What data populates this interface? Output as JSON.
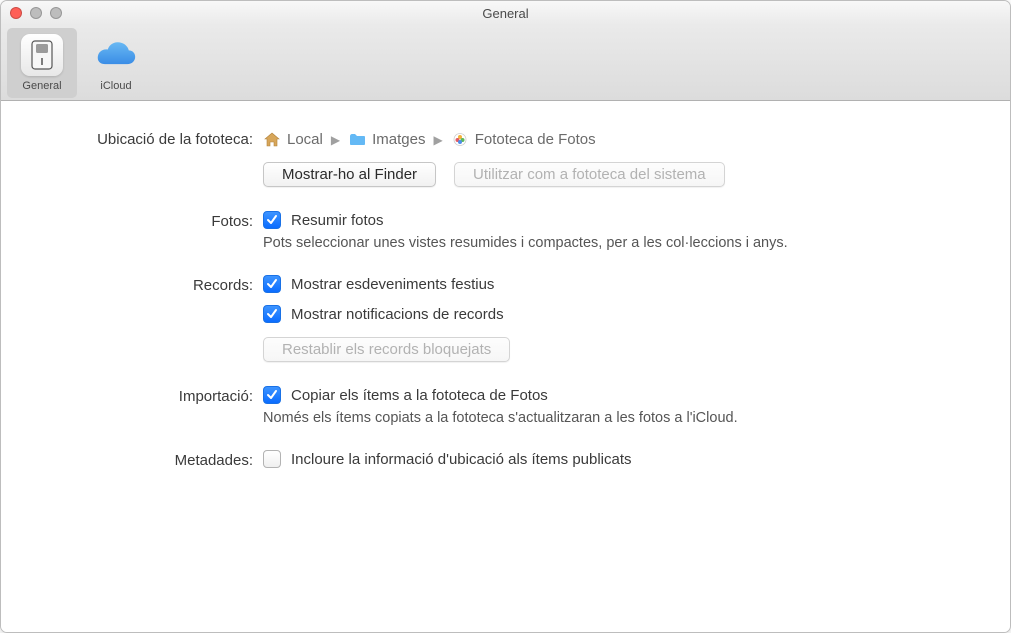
{
  "window": {
    "title": "General"
  },
  "toolbar": {
    "tabs": [
      {
        "label": "General",
        "selected": true,
        "icon": "switch"
      },
      {
        "label": "iCloud",
        "selected": false,
        "icon": "cloud"
      }
    ]
  },
  "rows": {
    "location": {
      "label": "Ubicació de la fototeca:",
      "crumbs": [
        {
          "label": "Local",
          "icon": "home"
        },
        {
          "label": "Imatges",
          "icon": "folder"
        },
        {
          "label": "Fototeca de Fotos",
          "icon": "photos"
        }
      ],
      "show_in_finder": "Mostrar-ho al Finder",
      "use_system_library": "Utilitzar com a fototeca del sistema"
    },
    "photos": {
      "label": "Fotos:",
      "summarize": {
        "label": "Resumir fotos",
        "checked": true
      },
      "desc": "Pots seleccionar unes vistes resumides i compactes, per a les col·leccions i anys."
    },
    "records": {
      "label": "Records:",
      "events": {
        "label": "Mostrar esdeveniments festius",
        "checked": true
      },
      "notifications": {
        "label": "Mostrar notificacions de records",
        "checked": true
      },
      "reset_blocked": "Restablir els records bloquejats"
    },
    "import": {
      "label": "Importació:",
      "copy": {
        "label": "Copiar els ítems a la fototeca de Fotos",
        "checked": true
      },
      "desc": "Només els ítems copiats a la fototeca s'actualitzaran a les fotos a l'iCloud."
    },
    "metadata": {
      "label": "Metadades:",
      "include_location": {
        "label": "Incloure la informació d'ubicació als ítems publicats",
        "checked": false
      }
    }
  }
}
